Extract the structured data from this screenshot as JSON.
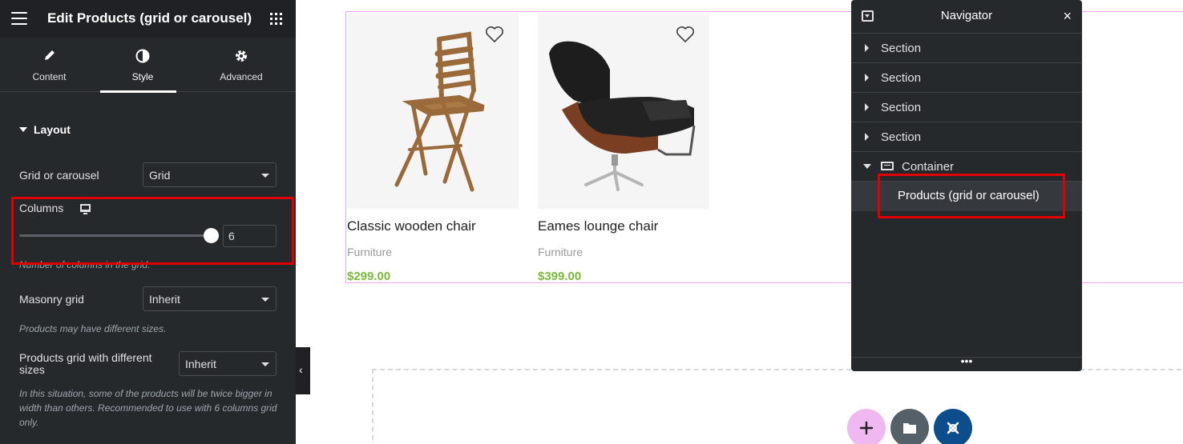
{
  "panel": {
    "title": "Edit Products (grid or carousel)",
    "tabs": [
      {
        "label": "Content",
        "icon": "pencil-icon"
      },
      {
        "label": "Style",
        "icon": "contrast-icon"
      },
      {
        "label": "Advanced",
        "icon": "gear-icon"
      }
    ],
    "active_tab": "Style",
    "section": "Layout",
    "grid_or_carousel": {
      "label": "Grid or carousel",
      "value": "Grid"
    },
    "columns": {
      "label": "Columns",
      "value": "6",
      "hint": "Number of columns in the grid."
    },
    "masonry": {
      "label": "Masonry grid",
      "value": "Inherit",
      "hint": "Products may have different sizes."
    },
    "different_sizes": {
      "label": "Products grid with different sizes",
      "value": "Inherit",
      "hint": "In this situation, some of the products will be twice bigger in width than others. Recommended to use with 6 columns grid only."
    }
  },
  "products": [
    {
      "title": "Classic wooden chair",
      "category": "Furniture",
      "price": "$299.00"
    },
    {
      "title": "Eames lounge chair",
      "category": "Furniture",
      "price": "$399.00"
    }
  ],
  "navigator": {
    "title": "Navigator",
    "items": [
      {
        "label": "Section"
      },
      {
        "label": "Section"
      },
      {
        "label": "Section"
      },
      {
        "label": "Section"
      },
      {
        "label": "Container"
      },
      {
        "label": "Products (grid or carousel)"
      }
    ],
    "footer": "•••"
  },
  "canvas_buttons": [
    {
      "icon": "plus-icon",
      "color": "#f0b8f0"
    },
    {
      "icon": "folder-icon",
      "color": "#556068"
    },
    {
      "icon": "xstore-icon",
      "color": "#0c4d8c"
    }
  ],
  "colors": {
    "highlight": "#e00000",
    "price": "#7ab83a",
    "outline": "#f0a6ee"
  }
}
